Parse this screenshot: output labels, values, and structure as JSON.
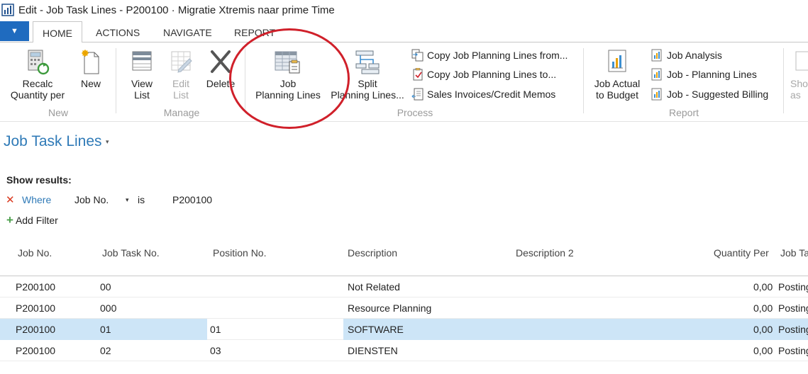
{
  "window": {
    "title": "Edit - Job Task Lines - P200100 · Migratie Xtremis naar prime Time",
    "app_icon": "bar-chart-icon"
  },
  "ribbon_tabs": [
    "HOME",
    "ACTIONS",
    "NAVIGATE",
    "REPORT"
  ],
  "app_menu_icon": "▼",
  "ribbon": {
    "new_group": {
      "label": "New",
      "recalc_line1": "Recalc",
      "recalc_line2": "Quantity per",
      "new": "New"
    },
    "manage_group": {
      "label": "Manage",
      "view_line1": "View",
      "view_line2": "List",
      "edit_line1": "Edit",
      "edit_line2": "List",
      "delete": "Delete"
    },
    "process_group": {
      "label": "Process",
      "job_line1": "Job",
      "job_line2": "Planning Lines",
      "split_line1": "Split",
      "split_line2": "Planning Lines...",
      "copy_from": "Copy Job Planning Lines from...",
      "copy_to": "Copy Job Planning Lines to...",
      "sales_invoices": "Sales Invoices/Credit Memos"
    },
    "report_group": {
      "label": "Report",
      "actual_line1": "Job Actual",
      "actual_line2": "to Budget",
      "job_analysis": "Job Analysis",
      "job_planning_lines": "Job - Planning Lines",
      "job_suggested_billing": "Job - Suggested Billing"
    },
    "overflow_line1": "Sho",
    "overflow_line2": "as"
  },
  "page": {
    "title": "Job Task Lines",
    "caret": "▾"
  },
  "filters": {
    "show_results": "Show results:",
    "remove": "✕",
    "where": "Where",
    "field": "Job No.",
    "caret": "▾",
    "operator": "is",
    "value": "P200100",
    "add_filter": "Add Filter",
    "add_icon": "+"
  },
  "grid": {
    "columns": [
      "Job No.",
      "Job Task No.",
      "Position No.",
      "Description",
      "Description 2",
      "Quantity Per",
      "Job Ta"
    ],
    "rows": [
      {
        "job_no": "P200100",
        "task_no": "00",
        "position_no": "",
        "description": "Not Related",
        "description2": "",
        "quantity_per": "0,00",
        "job_task_type": "Posting",
        "selected": false
      },
      {
        "job_no": "P200100",
        "task_no": "000",
        "position_no": "",
        "description": "Resource Planning",
        "description2": "",
        "quantity_per": "0,00",
        "job_task_type": "Posting",
        "selected": false
      },
      {
        "job_no": "P200100",
        "task_no": "01",
        "position_no": "01",
        "description": "SOFTWARE",
        "description2": "",
        "quantity_per": "0,00",
        "job_task_type": "Posting",
        "selected": true
      },
      {
        "job_no": "P200100",
        "task_no": "02",
        "position_no": "03",
        "description": "DIENSTEN",
        "description2": "",
        "quantity_per": "0,00",
        "job_task_type": "Posting",
        "selected": false
      }
    ]
  },
  "colors": {
    "accent": "#2f7ab7",
    "selection": "#cde5f7",
    "annotation": "#d0202a"
  }
}
